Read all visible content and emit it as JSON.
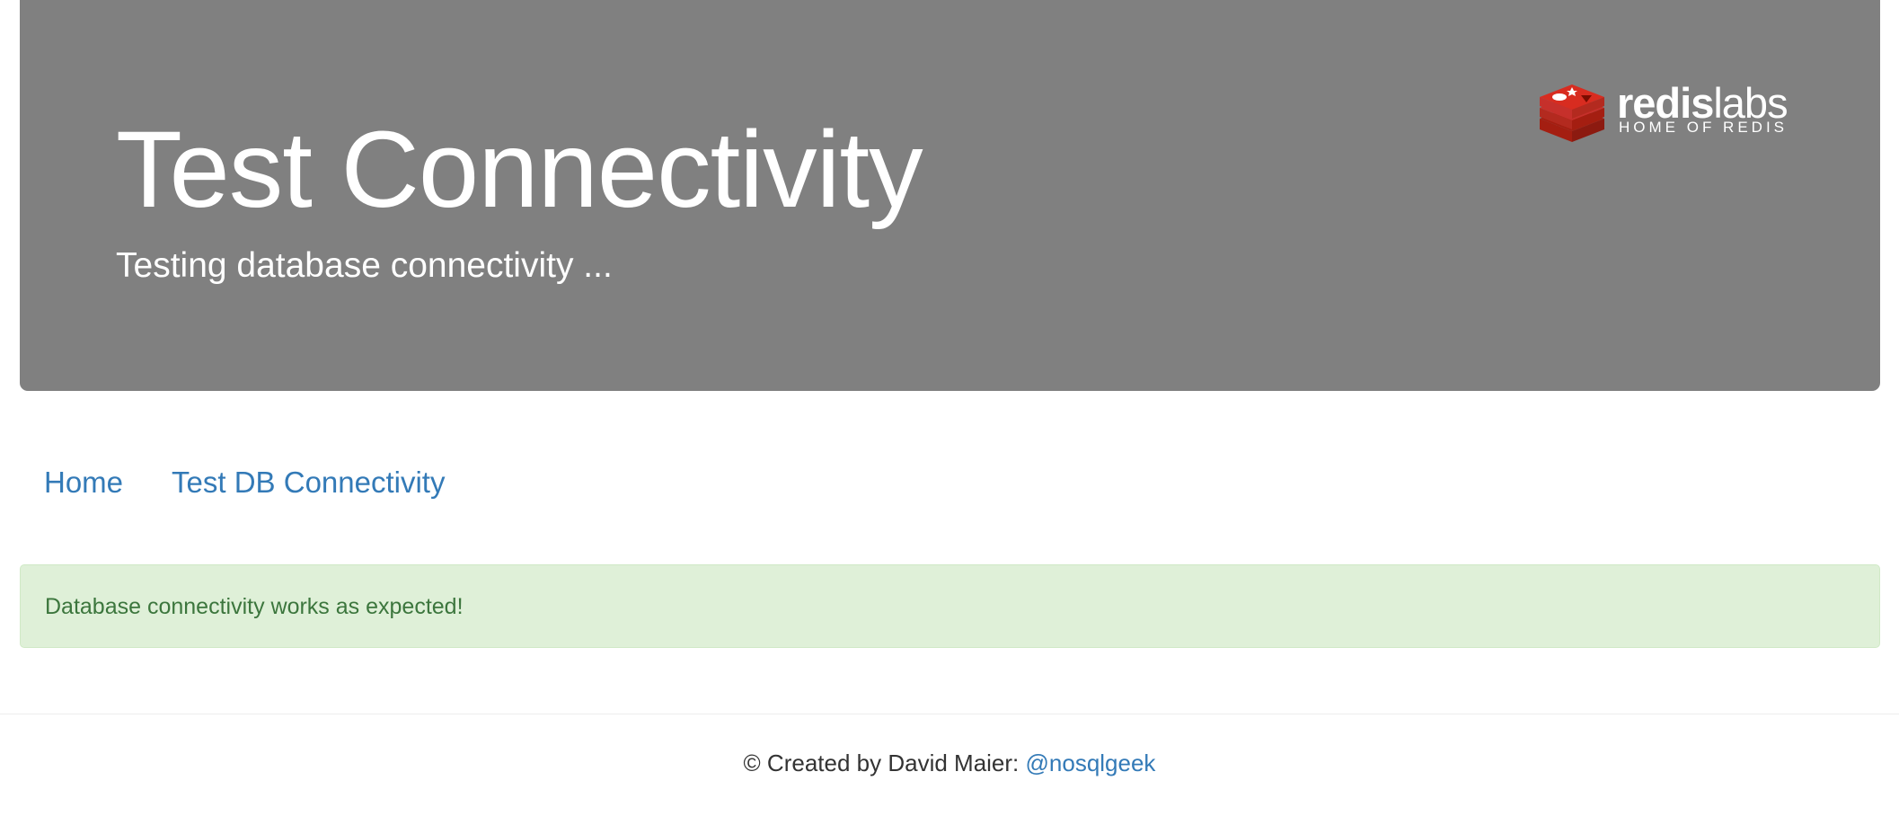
{
  "header": {
    "title": "Test Connectivity",
    "subtitle": "Testing database connectivity ...",
    "background_color": "#808080"
  },
  "logo": {
    "word_bold": "redis",
    "word_light": "labs",
    "tagline": "HOME OF REDIS",
    "icon": "redis-cube-icon",
    "brand_color": "#d82c20"
  },
  "nav": {
    "home_label": "Home",
    "test_db_label": "Test DB Connectivity",
    "link_color": "#337ab7"
  },
  "alert": {
    "message": "Database connectivity works as expected!",
    "type": "success",
    "background_color": "#dff0d8",
    "text_color": "#3c763d"
  },
  "footer": {
    "prefix": "© Created by David Maier: ",
    "link_text": "@nosqlgeek"
  }
}
